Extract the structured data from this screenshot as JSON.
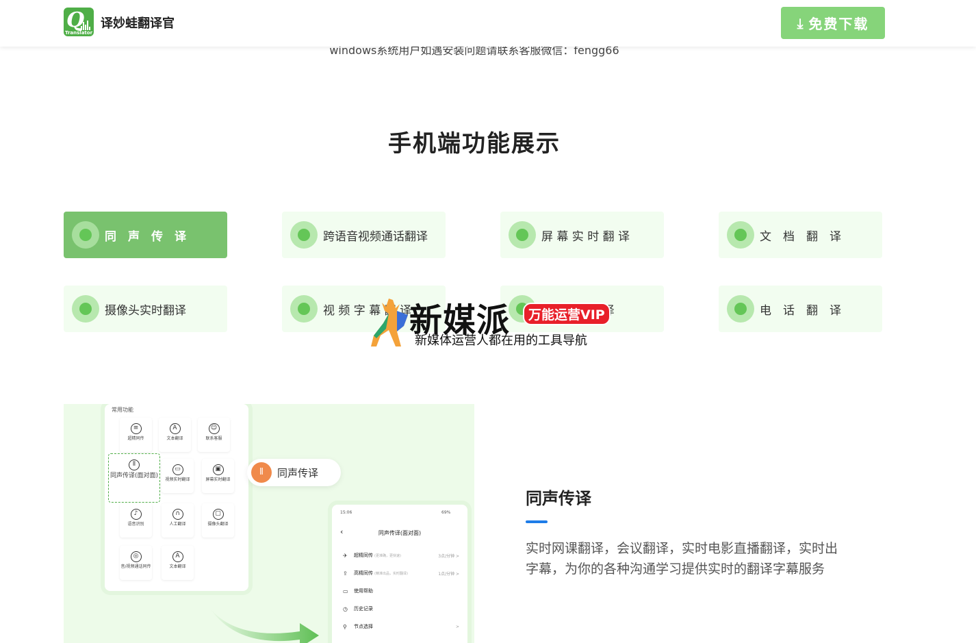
{
  "header": {
    "logo_letter": "Q",
    "logo_tag": "Translator",
    "brand": "译妙蛙翻译官",
    "download_label": "免费下载",
    "download_icon": "download-arrow-icon"
  },
  "notice": "windows系统用户如遇安装问题请联系客服微信：fengg66",
  "section_title": "手机端功能展示",
  "features": [
    {
      "label": "同　声　传　译",
      "icon": "microphone-wave-icon",
      "active": true
    },
    {
      "label": "跨语音视频通话翻译",
      "icon": "video-call-icon",
      "active": false
    },
    {
      "label": "屏 幕 实 时 翻 译",
      "icon": "screen-chat-icon",
      "active": false
    },
    {
      "label": "文　档　翻　译",
      "icon": "document-icon",
      "active": false
    },
    {
      "label": "摄像头实时翻译",
      "icon": "camera-icon",
      "active": false
    },
    {
      "label": "视 频 字 幕 翻 译",
      "icon": "video-subtitle-icon",
      "active": false
    },
    {
      "label": "音 视 频 翻 译",
      "icon": "audio-video-icon",
      "active": false
    },
    {
      "label": "电　话　翻　译",
      "icon": "phone-smile-icon",
      "active": false
    }
  ],
  "watermark": {
    "big": "新媒派",
    "badge": "万能运营VIP",
    "sub": "新媒体运营人都在用的工具导航"
  },
  "showcase": {
    "phone1_title": "常用功能",
    "grid": [
      {
        "label": "超精同传",
        "icon": "≡"
      },
      {
        "label": "文本翻译",
        "icon": "A"
      },
      {
        "label": "联系客服",
        "icon": "☺"
      },
      {
        "label": "同声传译(面对面)",
        "icon": "⦀"
      },
      {
        "label": "视频实时翻译",
        "icon": "▭"
      },
      {
        "label": "屏幕实时翻译",
        "icon": "▣"
      },
      {
        "label": "语音识别",
        "icon": "♪"
      },
      {
        "label": "人工翻译",
        "icon": "∩"
      },
      {
        "label": "摄像头翻译",
        "icon": "▢"
      },
      {
        "label": "音/视频通话同传",
        "icon": "◎"
      },
      {
        "label": "文本翻译",
        "icon": "A"
      }
    ],
    "pill_label": "同声传译",
    "phone2_time": "15:06",
    "phone2_battery": "69%",
    "phone2_title": "同声传译(面对面)",
    "phone2_rows": [
      {
        "label": "超精同传",
        "note": "(更准确，更快速)",
        "price": "3点/分钟 >"
      },
      {
        "label": "高精同传",
        "note": "(精准出品，实时翻译)",
        "price": "1点/分钟 >"
      },
      {
        "label": "使用帮助",
        "note": "",
        "price": ""
      },
      {
        "label": "历史记录",
        "note": "",
        "price": ""
      },
      {
        "label": "节点选择",
        "note": "",
        "price": ">"
      }
    ]
  },
  "description": {
    "title": "同声传译",
    "text": "实时网课翻译，会议翻译，实时电影直播翻译，实时出字幕，为你的各种沟通学习提供实时的翻译字幕服务"
  },
  "colors": {
    "brand_green": "#4fae47",
    "active_card": "#79c26e",
    "card_bg": "#f2fdf0",
    "download_btn": "#86d47a",
    "accent_blue": "#1e7ce8"
  }
}
